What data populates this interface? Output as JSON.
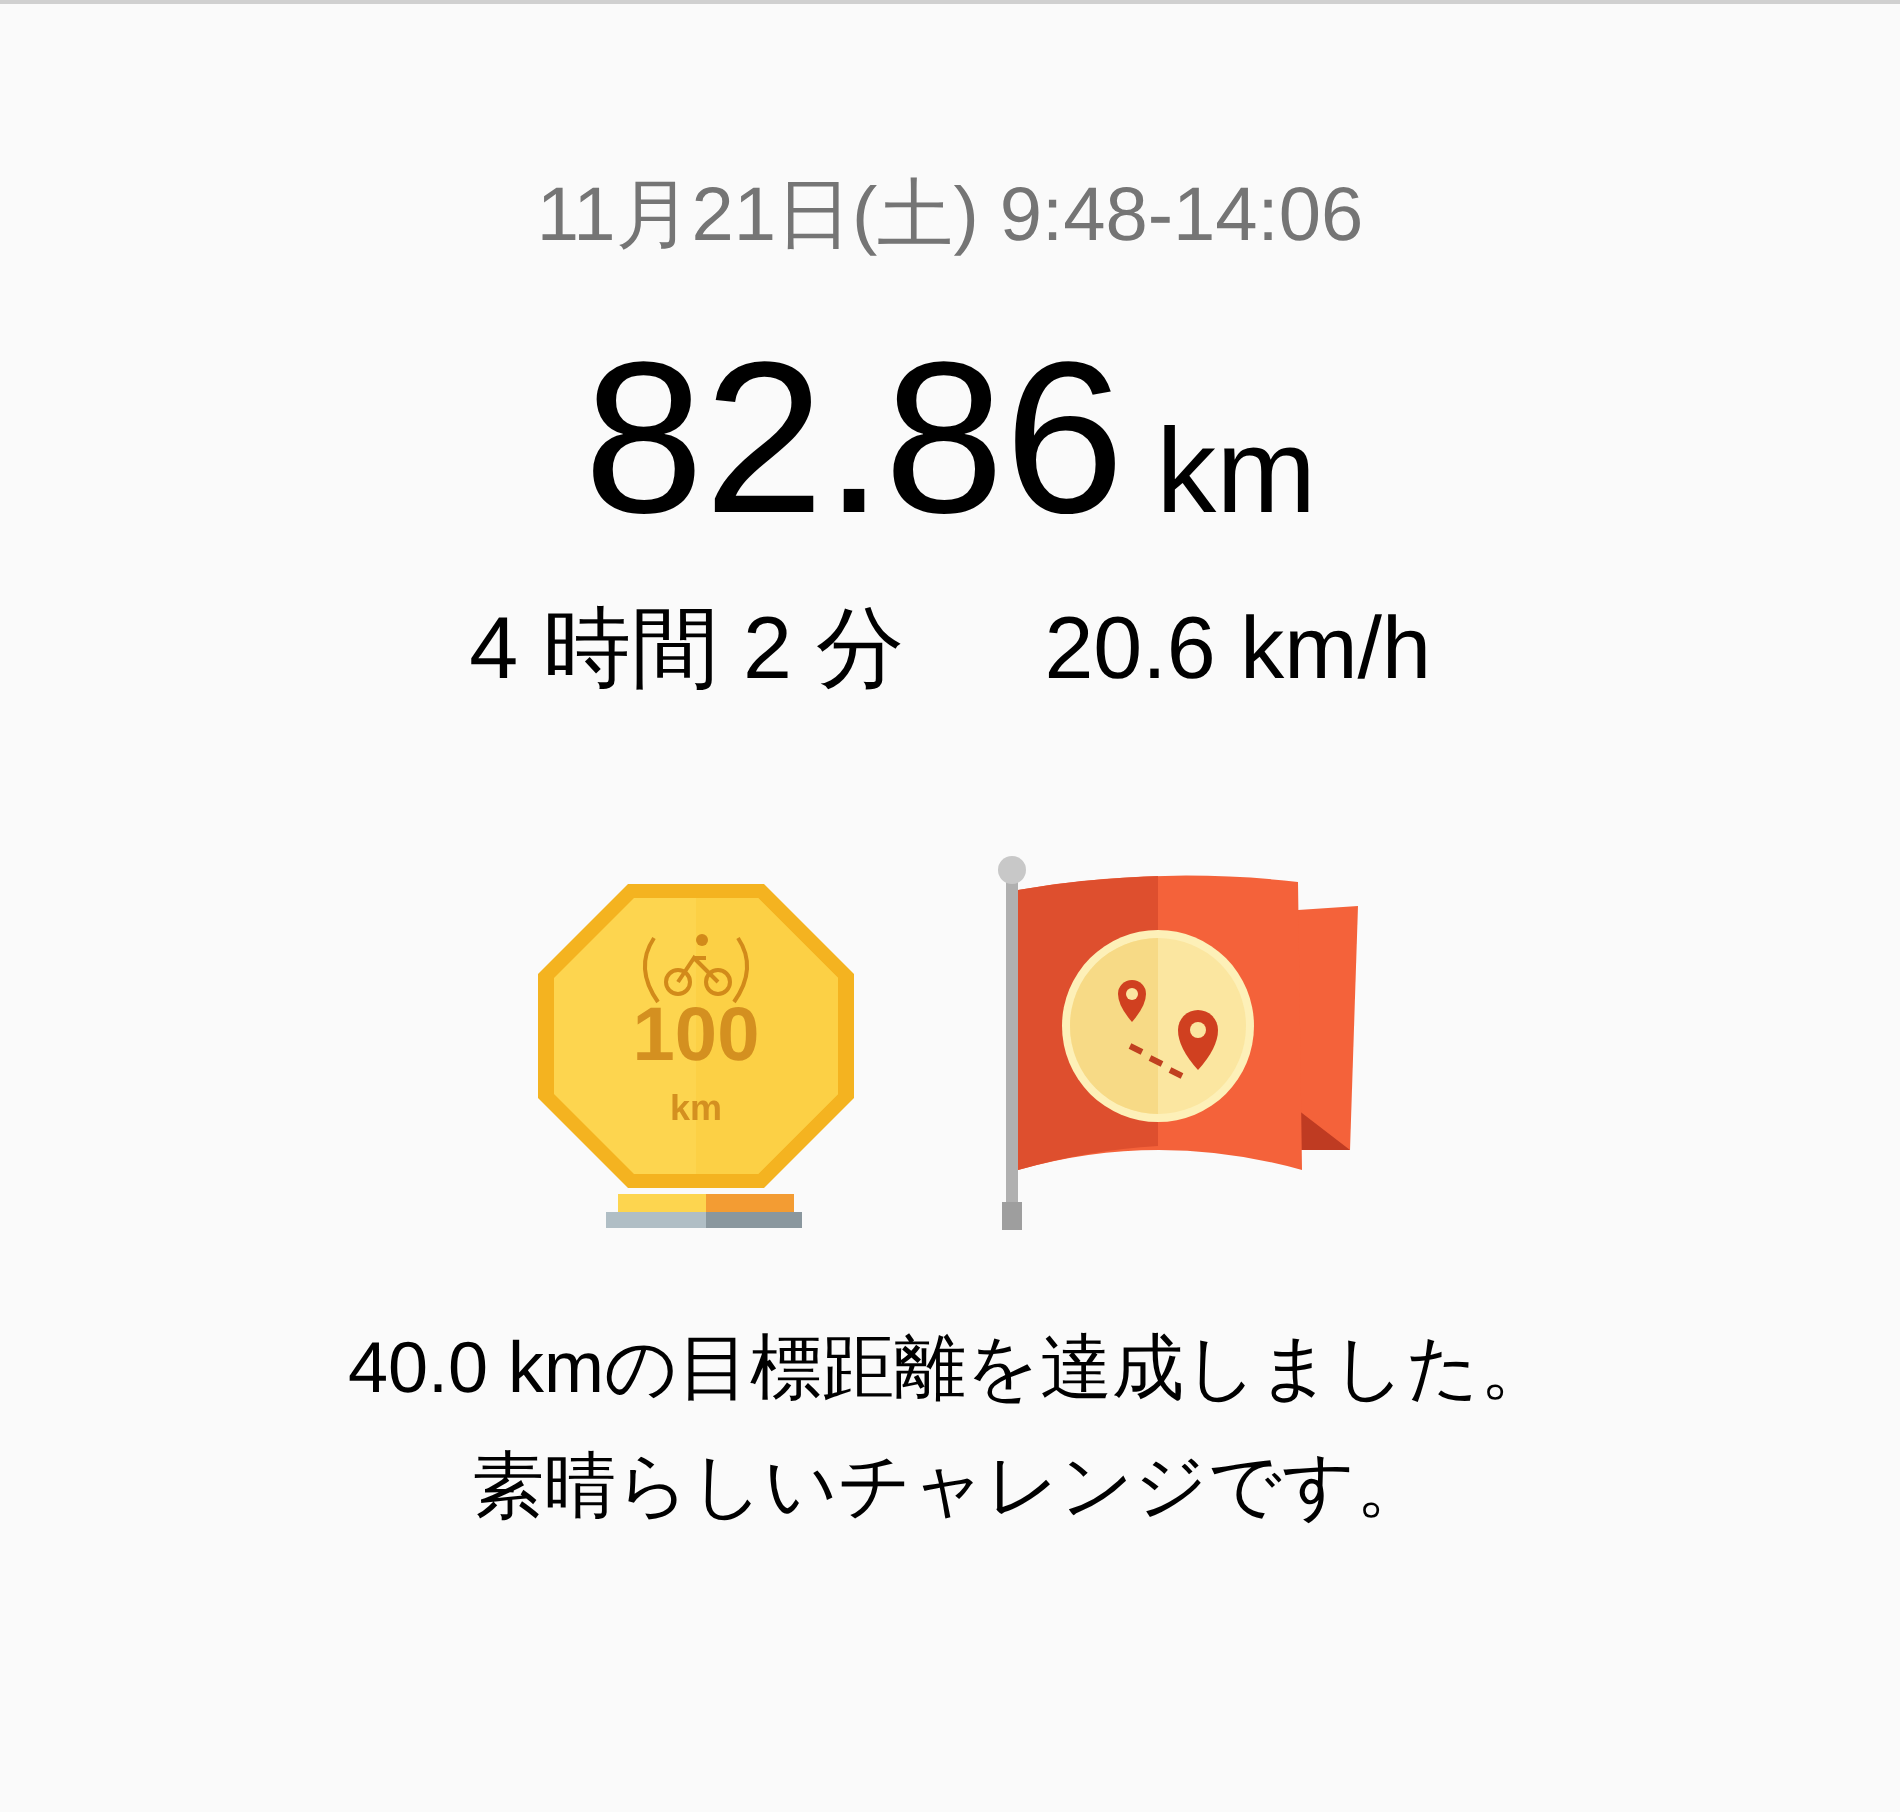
{
  "date_range": "11月21日(土) 9:48-14:06",
  "distance": {
    "value": "82.86",
    "unit": "km"
  },
  "duration": "4 時間 2 分",
  "speed": "20.6 km/h",
  "badge": {
    "number": "100",
    "unit": "km"
  },
  "message": [
    "40.0 kmの目標距離を達成しました。",
    "素晴らしいチャレンジです。"
  ]
}
